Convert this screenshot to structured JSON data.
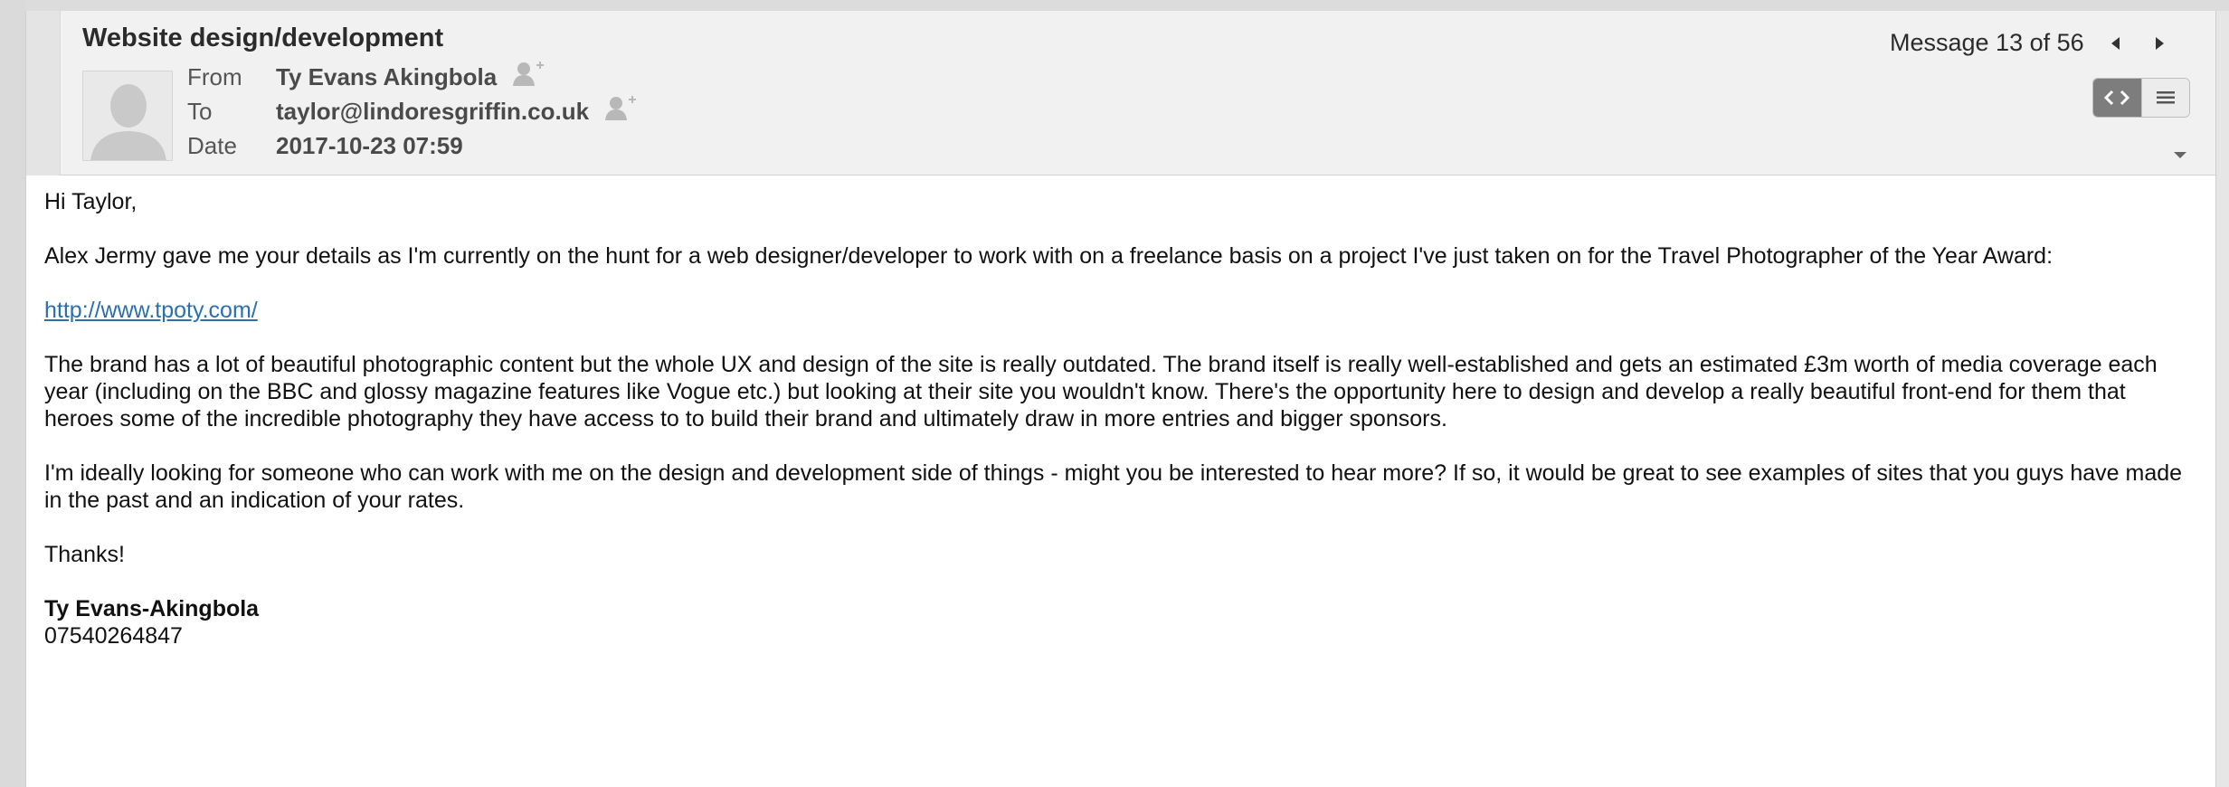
{
  "email": {
    "subject": "Website design/development",
    "from_label": "From",
    "from_value": "Ty Evans Akingbola",
    "to_label": "To",
    "to_value": "taylor@lindoresgriffin.co.uk",
    "date_label": "Date",
    "date_value": "2017-10-23 07:59"
  },
  "navigation": {
    "message_position": "Message 13 of 56",
    "prev_icon": "triangle-left-icon",
    "next_icon": "triangle-right-icon"
  },
  "view_toggle": {
    "html_view_icon": "code-brackets-icon",
    "plain_view_icon": "lines-icon",
    "active": "html"
  },
  "body": {
    "greeting": "Hi Taylor,",
    "paragraph_1": "Alex Jermy gave me your details as I'm currently on the hunt for a web designer/developer to work with on a freelance basis on a project I've just taken on for the Travel Photographer of the Year Award:",
    "link": "http://www.tpoty.com/",
    "paragraph_2": "The brand has a lot of beautiful photographic content but the whole UX and design of the site is really outdated. The brand itself is really well-established and gets an estimated £3m worth of media coverage each year (including on the BBC and glossy magazine features like Vogue etc.) but looking at their site you wouldn't know. There's the opportunity here to design and develop a really beautiful front-end for them that heroes some of the incredible photography they have access to to build their brand and ultimately draw in more entries and bigger sponsors.",
    "paragraph_3": "I'm ideally looking for someone who can work with me on the design and development side of things - might you be interested to hear more?  If so, it would be great to see examples of sites that you guys have made in the past and an indication of your rates.",
    "thanks": "Thanks!",
    "signature_name": "Ty Evans-Akingbola",
    "signature_phone": "07540264847"
  }
}
